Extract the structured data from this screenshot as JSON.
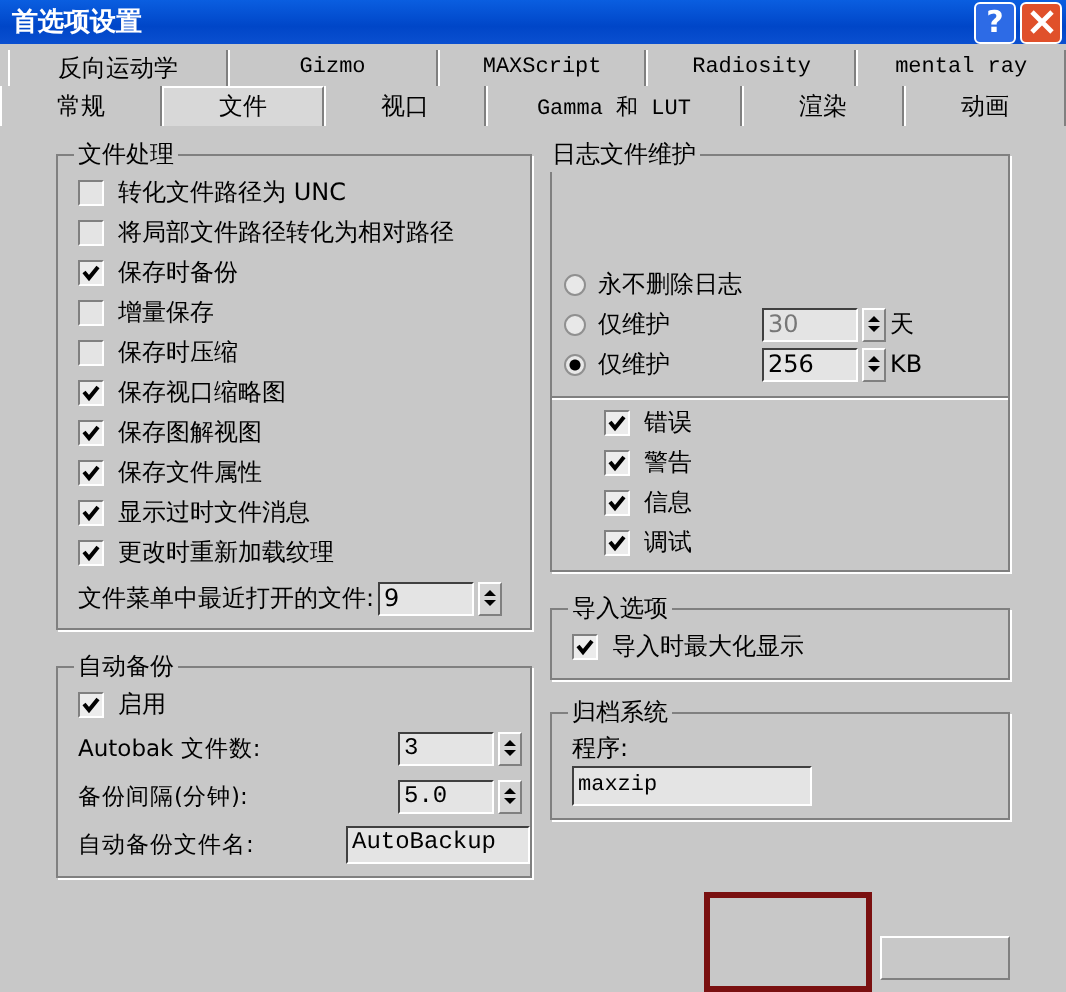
{
  "window": {
    "title": "首选项设置",
    "help": "?"
  },
  "tabs_row_1": [
    {
      "label": "反向运动学",
      "selected": false
    },
    {
      "label": "Gizmo",
      "selected": false
    },
    {
      "label": "MAXScript",
      "selected": false
    },
    {
      "label": "Radiosity",
      "selected": false
    },
    {
      "label": "mental ray",
      "selected": false
    }
  ],
  "tabs_row_2": [
    {
      "label": "常规",
      "selected": false
    },
    {
      "label": "文件",
      "selected": true
    },
    {
      "label": "视口",
      "selected": false
    },
    {
      "label": "Gamma 和 LUT",
      "selected": false
    },
    {
      "label": "渲染",
      "selected": false
    },
    {
      "label": "动画",
      "selected": false
    }
  ],
  "file_handling": {
    "title": "文件处理",
    "options": [
      {
        "label": "转化文件路径为 UNC",
        "checked": false
      },
      {
        "label": "将局部文件路径转化为相对路径",
        "checked": false
      },
      {
        "label": "保存时备份",
        "checked": true
      },
      {
        "label": "增量保存",
        "checked": false
      },
      {
        "label": "保存时压缩",
        "checked": false
      },
      {
        "label": "保存视口缩略图",
        "checked": true
      },
      {
        "label": "保存图解视图",
        "checked": true
      },
      {
        "label": "保存文件属性",
        "checked": true
      },
      {
        "label": "显示过时文件消息",
        "checked": true
      },
      {
        "label": "更改时重新加载纹理",
        "checked": true
      }
    ],
    "recent_files": {
      "label": "文件菜单中最近打开的文件:",
      "value": "9"
    }
  },
  "auto_backup": {
    "title": "自动备份",
    "enable": {
      "label": "启用",
      "checked": true
    },
    "fields": [
      {
        "kind": "spinner",
        "label": "Autobak 文件数:",
        "value": "3"
      },
      {
        "kind": "spinner",
        "label": "备份间隔(分钟):",
        "value": "5.0"
      },
      {
        "kind": "text",
        "label": "自动备份文件名:",
        "value": "AutoBackup"
      }
    ]
  },
  "log_maintenance": {
    "title": "日志文件维护",
    "options": [
      {
        "label": "永不删除日志",
        "selected": false
      },
      {
        "label": "仅维护",
        "selected": false,
        "value": "30",
        "unit": "天",
        "disabled": true
      },
      {
        "label": "仅维护",
        "selected": true,
        "value": "256",
        "unit": "KB",
        "disabled": false
      }
    ],
    "levels": [
      {
        "label": "错误",
        "checked": true
      },
      {
        "label": "警告",
        "checked": true
      },
      {
        "label": "信息",
        "checked": true
      },
      {
        "label": "调试",
        "checked": true
      }
    ]
  },
  "import_options": {
    "title": "导入选项",
    "options": [
      {
        "label": "导入时最大化显示",
        "checked": true
      }
    ]
  },
  "archive": {
    "title": "归档系统",
    "program_label": "程序:",
    "program_value": "maxzip"
  }
}
